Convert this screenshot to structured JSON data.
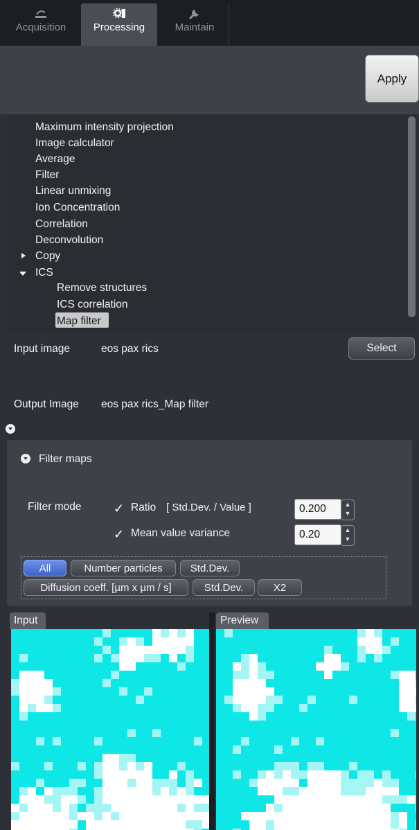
{
  "tabs": [
    {
      "label": "Acquisition",
      "icon": "acquisition-icon",
      "active": false
    },
    {
      "label": "Processing",
      "icon": "gear-icon",
      "active": true
    },
    {
      "label": "Maintain",
      "icon": "wrench-icon",
      "active": false
    }
  ],
  "toolbar": {
    "apply_label": "Apply"
  },
  "tree": {
    "items": [
      {
        "label": "Maximum intensity projection"
      },
      {
        "label": "Image calculator"
      },
      {
        "label": "Average"
      },
      {
        "label": "Filter"
      },
      {
        "label": "Linear unmixing"
      },
      {
        "label": "Ion Concentration"
      },
      {
        "label": "Correlation"
      },
      {
        "label": "Deconvolution"
      },
      {
        "label": "Copy",
        "expander": "collapsed"
      },
      {
        "label": "ICS",
        "expander": "expanded"
      },
      {
        "label": "Remove structures"
      },
      {
        "label": "ICS correlation"
      },
      {
        "label": "Map filter",
        "selected": true
      }
    ]
  },
  "io": {
    "input_label": "Input image",
    "input_value": "eos pax rics",
    "select_label": "Select",
    "output_label": "Output Image",
    "output_value": "eos pax rics_Map filter"
  },
  "filter_maps": {
    "title": "Filter maps",
    "mode_label": "Filter mode",
    "ratio": {
      "checked": true,
      "label": "Ratio",
      "detail": "[ Std.Dev. / Value ]",
      "value": "0.200"
    },
    "variance": {
      "checked": true,
      "label": "Mean value variance",
      "value": "0.20"
    },
    "chips_row1": [
      {
        "label": "All",
        "active": true
      },
      {
        "label": "Number particles",
        "active": false
      },
      {
        "label": "Std.Dev.",
        "active": false
      }
    ],
    "chips_row2": [
      {
        "label": "Diffusion coeff. [µm x µm / s]",
        "active": false
      },
      {
        "label": "Std.Dev.",
        "active": false
      },
      {
        "label": "X2",
        "active": false
      }
    ]
  },
  "panes": {
    "input_label": "Input",
    "preview_label": "Preview"
  },
  "colors": {
    "accent": "#4a6fd6",
    "map_cyan": "#0fe6e6",
    "map_white": "#ffffff",
    "map_light": "#a6f5f5"
  },
  "check_glyph": "✓"
}
